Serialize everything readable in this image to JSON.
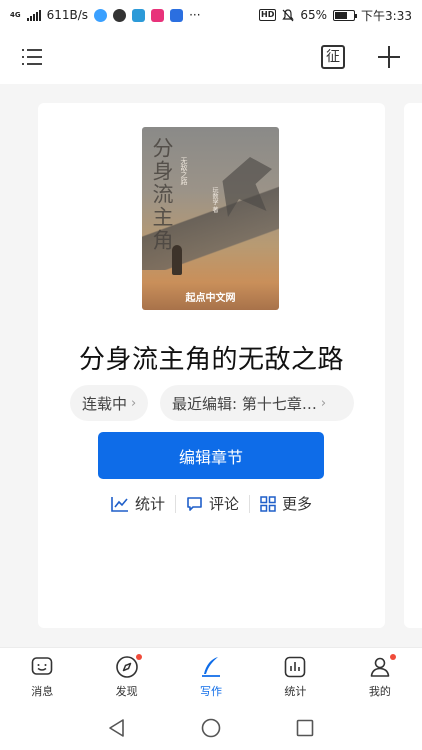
{
  "status_bar": {
    "network": "4G",
    "speed": "611B/s",
    "more": "···",
    "hd": "HD",
    "battery": "65%",
    "time": "下午3:33"
  },
  "toolbar": {
    "left_icon": "list-menu-icon",
    "stamp_label": "征",
    "right_icon": "plus-icon"
  },
  "book": {
    "cover": {
      "title_art": "分身流主角",
      "subtitle": "无敌之路",
      "author": "玩数学 著",
      "brand": "起点中文网"
    },
    "title": "分身流主角的无敌之路",
    "status_chip": "连载中",
    "recent_chip": "最近编辑: 第十七章…",
    "edit_button": "编辑章节",
    "actions": [
      {
        "label": "统计",
        "icon": "chart-line-icon"
      },
      {
        "label": "评论",
        "icon": "comment-icon"
      },
      {
        "label": "更多",
        "icon": "grid-icon"
      }
    ]
  },
  "bottom_nav": [
    {
      "label": "消息",
      "icon": "message-icon",
      "badge": false
    },
    {
      "label": "发现",
      "icon": "compass-icon",
      "badge": true
    },
    {
      "label": "写作",
      "icon": "pen-icon",
      "badge": false,
      "active": true
    },
    {
      "label": "统计",
      "icon": "stats-icon",
      "badge": false
    },
    {
      "label": "我的",
      "icon": "profile-icon",
      "badge": true
    }
  ],
  "colors": {
    "accent": "#0e6ce8",
    "badge": "#f04b3a",
    "background": "#f5f5f5"
  }
}
